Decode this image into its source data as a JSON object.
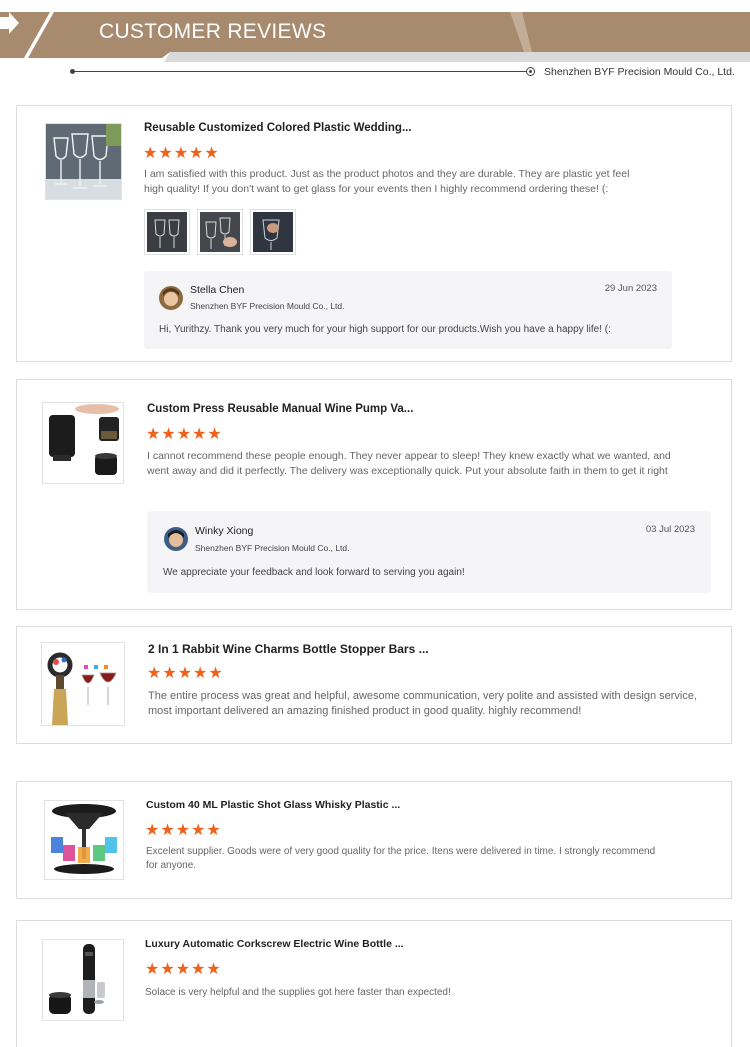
{
  "header": {
    "title": "CUSTOMER REVIEWS",
    "company": "Shenzhen BYF Precision Mould Co., Ltd."
  },
  "colors": {
    "banner_dark": "#a88a6f",
    "banner_light": "#d9d9d9",
    "star": "#f0621c"
  },
  "reviews": [
    {
      "title": "Reusable Customized Colored Plastic Wedding...",
      "stars": "★★★★★",
      "rating": 5,
      "text": "I am satisfied with this product. Just as the product photos and they are durable. They are plastic yet feel high quality! If you don't want to get glass for your events then I highly recommend ordering these! (:",
      "thumbnail_icon": "wine-glasses-icon",
      "photos": [
        "glass-photo-1",
        "glass-photo-2",
        "glass-photo-3"
      ],
      "reply": {
        "name": "Stella Chen",
        "company": "Shenzhen BYF Precision Mould Co., Ltd.",
        "date": "29 Jun 2023",
        "text": "Hi, Yurithzy. Thank you very much for your high support for our products.Wish you have a happy life! (:"
      }
    },
    {
      "title": "Custom Press Reusable Manual Wine Pump Va...",
      "stars": "★★★★★",
      "rating": 5,
      "text": "I cannot recommend these people enough. They never appear to sleep!  They knew exactly what we wanted, and went away and did it perfectly. The delivery was exceptionally quick. Put your absolute faith in them to get it right",
      "thumbnail_icon": "wine-pump-stopper-icon",
      "reply": {
        "name": "Winky Xiong",
        "company": "Shenzhen BYF Precision Mould Co., Ltd.",
        "date": "03 Jul 2023",
        "text": "We appreciate your feedback and look forward to serving you again!"
      }
    },
    {
      "title": "2 In 1 Rabbit Wine Charms Bottle Stopper Bars ...",
      "stars": "★★★★★",
      "rating": 5,
      "text": "The entire process was great and helpful, awesome communication, very polite and assisted with design service, most important delivered an amazing finished product in good quality. highly recommend!",
      "thumbnail_icon": "wine-charm-stopper-icon"
    },
    {
      "title": "Custom 40 ML Plastic Shot Glass Whisky Plastic ...",
      "stars": "★★★★★",
      "rating": 5,
      "text": "Excelent supplier. Goods were of very good quality for the price. Itens were delivered in time. I strongly recommend for anyone.",
      "thumbnail_icon": "shot-glass-dispenser-icon"
    },
    {
      "title": "Luxury Automatic Corkscrew Electric Wine Bottle ...",
      "stars": "★★★★★",
      "rating": 5,
      "text": "Solace is very helpful and the supplies got here faster than expected!",
      "thumbnail_icon": "electric-corkscrew-icon"
    }
  ]
}
